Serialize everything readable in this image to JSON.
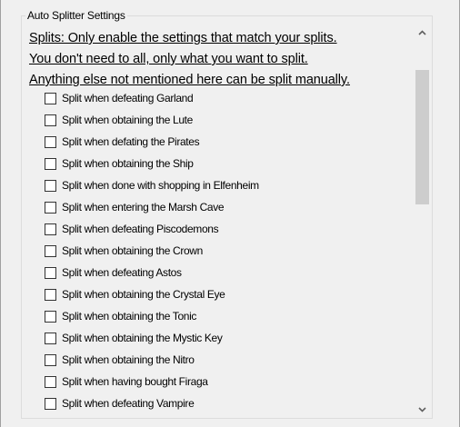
{
  "groupbox": {
    "title": "Auto Splitter Settings"
  },
  "notes": [
    "Splits: Only enable the settings that match your splits.",
    "You don't need to all, only what you want to split.",
    "Anything else not mentioned here can be split manually."
  ],
  "options": [
    {
      "label": "Split when defeating Garland",
      "checked": false
    },
    {
      "label": "Split when obtaining the Lute",
      "checked": false
    },
    {
      "label": "Split when defating the Pirates",
      "checked": false
    },
    {
      "label": "Split when obtaining the Ship",
      "checked": false
    },
    {
      "label": "Split when done with shopping in Elfenheim",
      "checked": false
    },
    {
      "label": "Split when entering the Marsh Cave",
      "checked": false
    },
    {
      "label": "Split when defeating Piscodemons",
      "checked": false
    },
    {
      "label": "Split when obtaining the Crown",
      "checked": false
    },
    {
      "label": "Split when defeating Astos",
      "checked": false
    },
    {
      "label": "Split when obtaining the Crystal Eye",
      "checked": false
    },
    {
      "label": "Split when obtaining the Tonic",
      "checked": false
    },
    {
      "label": "Split when obtaining the Mystic Key",
      "checked": false
    },
    {
      "label": "Split when obtaining the Nitro",
      "checked": false
    },
    {
      "label": "Split when having bought Firaga",
      "checked": false
    },
    {
      "label": "Split when defeating Vampire",
      "checked": false
    }
  ],
  "scrollbar": {
    "up_icon": "chevron-up-icon",
    "down_icon": "chevron-down-icon",
    "position_fraction": 0.0
  },
  "colors": {
    "background": "#f0f0f0",
    "thumb": "#cdcdcd",
    "checkbox_border": "#333333"
  }
}
